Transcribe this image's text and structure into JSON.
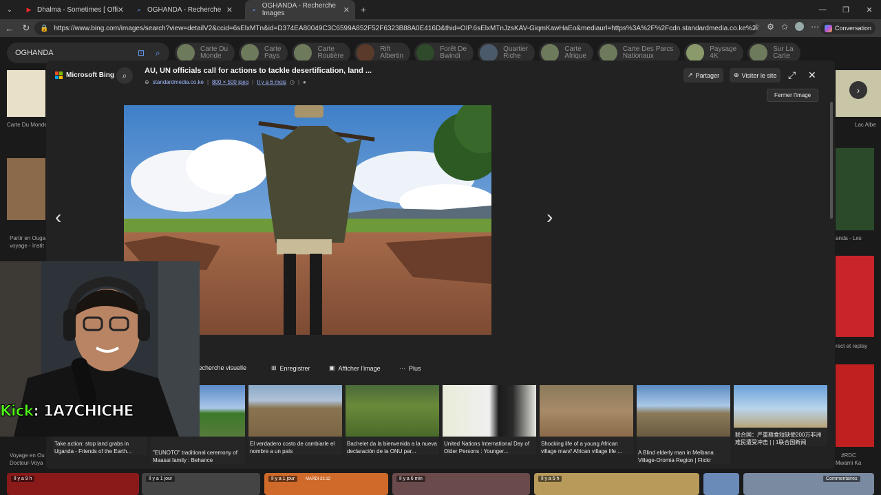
{
  "browser": {
    "tabs": [
      {
        "title": "Dhalma - Sometimes [ Official Mu",
        "icon": "youtube-icon"
      },
      {
        "title": "OGHANDA - Recherche",
        "icon": "bing-icon"
      },
      {
        "title": "OGHANDA - Recherche Images",
        "icon": "bing-icon",
        "active": true
      }
    ],
    "url": "https://www.bing.com/images/search?view=detailV2&ccid=6sElxMTn&id=D374EA80049C3C6599A852F52F6323B88A0E416D&thid=OIP.6sElxMTnJzsKAV-GiqmKawHaEo&mediaurl=https%3A%2F%2Fcdn.standardmedia.co.ke%2Fimages%2Fwys...",
    "conversation_label": "Conversation"
  },
  "search": {
    "query": "OGHANDA",
    "chips": [
      [
        "Carte Du",
        "Monde"
      ],
      [
        "Carte",
        "Pays"
      ],
      [
        "Carte",
        "Routière"
      ],
      [
        "Rift",
        "Albertin"
      ],
      [
        "Forêt De",
        "Bwindi"
      ],
      [
        "Quartier",
        "Riche"
      ],
      [
        "Carte",
        "Afrique"
      ],
      [
        "Carte Des Parcs",
        "Nationaux"
      ],
      [
        "Paysage",
        "4K"
      ],
      [
        "Sur La",
        "Carte"
      ]
    ]
  },
  "background": {
    "captions": {
      "carte_du_monde": "Carte Du Monde",
      "lac_albert": "Lac Albe",
      "partir_en": "Partir en Ouga",
      "voyage_inst": "voyage - Instit",
      "anda_les": "anda - Les",
      "rect_replay": "rect et replay",
      "voyage_en": "Voyage en Ou",
      "docteur": "Docteur-Voya",
      "rdc": "#RDC",
      "mwami": "Mwami Ka"
    },
    "bottom_tiles": [
      "Il y a 9 h",
      "Il y a 1 jour",
      "Il y a 1 jour",
      "Il y a 6 min",
      "Il y a 5 h",
      "Commentaires"
    ],
    "bottom_tile_text": "MARDI 23.12"
  },
  "modal": {
    "brand": "Microsoft Bing",
    "title": "AU, UN officials call for actions to tackle desertification, land ...",
    "source": "standardmedia.co.ke",
    "size": "800 × 500 jpeg",
    "age": "Il y a 6 mois",
    "share_label": "Partager",
    "visit_label": "Visiter le site",
    "close_tooltip": "Fermer l'image",
    "actions": {
      "visual": "Recherche visuelle",
      "save": "Enregistrer",
      "show": "Afficher l'image",
      "more": "Plus"
    },
    "related": [
      {
        "caption": "Take action: stop land grabs in Uganda - Friends of the Earth..."
      },
      {
        "caption": "\"EUNOTO\" traditional ceremony of Maasai family : Behance"
      },
      {
        "caption": "El verdadero costo de cambiarle el nombre a un país"
      },
      {
        "caption": "Bachelet da la bienvenida a la nueva declaración de la ONU par..."
      },
      {
        "caption": "United Nations International Day of Older Persons : Younger..."
      },
      {
        "caption": "Shocking life of a young African village man// African village life ..."
      },
      {
        "caption": "A Blind elderly man in Melbana Village-Oromia Region | Flickr"
      },
      {
        "caption": "联合国：严重粮食短缺使200万非洲难民遭受冲击 | | 1联合国新闻"
      }
    ]
  },
  "overlay": {
    "kick_prefix": "Kick",
    "kick_handle": " : 1A7CHICHE"
  }
}
